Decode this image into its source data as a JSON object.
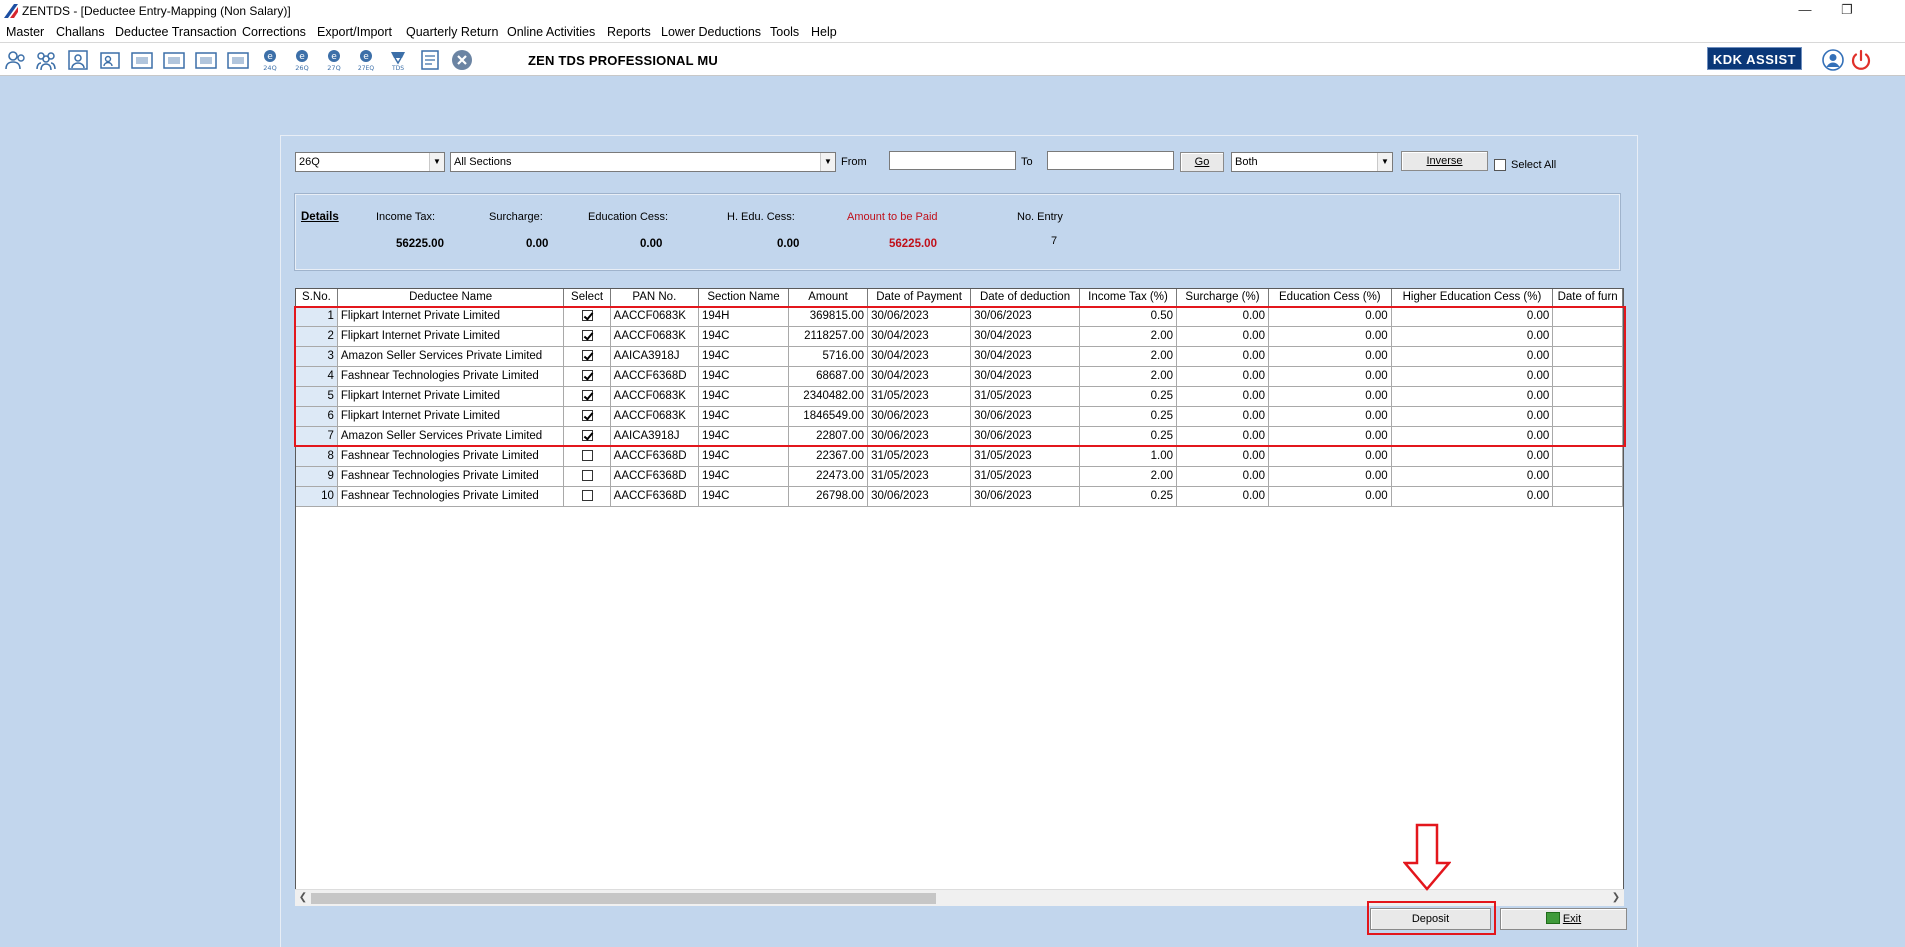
{
  "window": {
    "title": "ZENTDS - [Deductee Entry-Mapping (Non Salary)]",
    "minimize": "—",
    "restore": "❐"
  },
  "menu": [
    "Master",
    "Challans",
    "Deductee Transaction",
    "Corrections",
    "Export/Import",
    "Quarterly Return",
    "Online Activities",
    "Reports",
    "Lower Deductions",
    "Tools",
    "Help"
  ],
  "toolbar": {
    "icon_labels": [
      "24Q",
      "26Q",
      "27Q",
      "27EQ",
      "TDS"
    ],
    "brand": "ZEN TDS PROFESSIONAL MU",
    "assist_label": "KDK ASSIST"
  },
  "filters": {
    "form_type": "26Q",
    "section": "All Sections",
    "from_label": "From",
    "from_value": "",
    "to_label": "To",
    "to_value": "",
    "go_label": "Go",
    "mode": "Both",
    "inverse_label": "Inverse",
    "select_all_label": "Select All"
  },
  "details": {
    "title": "Details",
    "income_tax_label": "Income Tax:",
    "income_tax": "56225.00",
    "surcharge_label": "Surcharge:",
    "surcharge": "0.00",
    "edu_cess_label": "Education Cess:",
    "edu_cess": "0.00",
    "h_edu_cess_label": "H. Edu. Cess:",
    "h_edu_cess": "0.00",
    "amount_label": "Amount to be Paid",
    "amount": "56225.00",
    "entries_label": "No. Entry",
    "entries": "7",
    "amount_color": "#c0101a"
  },
  "grid": {
    "columns": [
      "S.No.",
      "Deductee Name",
      "Select",
      "PAN No.",
      "Section Name",
      "Amount",
      "Date of Payment",
      "Date of deduction",
      "Income Tax (%)",
      "Surcharge (%)",
      "Education Cess (%)",
      "Higher Education Cess (%)",
      "Date of furn"
    ],
    "rows": [
      {
        "sno": "1",
        "name": "Flipkart Internet Private Limited",
        "selected": true,
        "pan": "AACCF0683K",
        "section": "194H",
        "amount": "369815.00",
        "payment_date": "30/06/2023",
        "deduction_date": "30/06/2023",
        "it": "0.50",
        "sur": "0.00",
        "edu": "0.00",
        "hedu": "0.00"
      },
      {
        "sno": "2",
        "name": "Flipkart Internet Private Limited",
        "selected": true,
        "pan": "AACCF0683K",
        "section": "194C",
        "amount": "2118257.00",
        "payment_date": "30/04/2023",
        "deduction_date": "30/04/2023",
        "it": "2.00",
        "sur": "0.00",
        "edu": "0.00",
        "hedu": "0.00"
      },
      {
        "sno": "3",
        "name": "Amazon Seller Services Private Limited",
        "selected": true,
        "pan": "AAICA3918J",
        "section": "194C",
        "amount": "5716.00",
        "payment_date": "30/04/2023",
        "deduction_date": "30/04/2023",
        "it": "2.00",
        "sur": "0.00",
        "edu": "0.00",
        "hedu": "0.00"
      },
      {
        "sno": "4",
        "name": "Fashnear Technologies Private Limited",
        "selected": true,
        "pan": "AACCF6368D",
        "section": "194C",
        "amount": "68687.00",
        "payment_date": "30/04/2023",
        "deduction_date": "30/04/2023",
        "it": "2.00",
        "sur": "0.00",
        "edu": "0.00",
        "hedu": "0.00"
      },
      {
        "sno": "5",
        "name": "Flipkart Internet Private Limited",
        "selected": true,
        "pan": "AACCF0683K",
        "section": "194C",
        "amount": "2340482.00",
        "payment_date": "31/05/2023",
        "deduction_date": "31/05/2023",
        "it": "0.25",
        "sur": "0.00",
        "edu": "0.00",
        "hedu": "0.00"
      },
      {
        "sno": "6",
        "name": "Flipkart Internet Private Limited",
        "selected": true,
        "pan": "AACCF0683K",
        "section": "194C",
        "amount": "1846549.00",
        "payment_date": "30/06/2023",
        "deduction_date": "30/06/2023",
        "it": "0.25",
        "sur": "0.00",
        "edu": "0.00",
        "hedu": "0.00"
      },
      {
        "sno": "7",
        "name": "Amazon Seller Services Private Limited",
        "selected": true,
        "pan": "AAICA3918J",
        "section": "194C",
        "amount": "22807.00",
        "payment_date": "30/06/2023",
        "deduction_date": "30/06/2023",
        "it": "0.25",
        "sur": "0.00",
        "edu": "0.00",
        "hedu": "0.00"
      },
      {
        "sno": "8",
        "name": "Fashnear Technologies Private Limited",
        "selected": false,
        "pan": "AACCF6368D",
        "section": "194C",
        "amount": "22367.00",
        "payment_date": "31/05/2023",
        "deduction_date": "31/05/2023",
        "it": "1.00",
        "sur": "0.00",
        "edu": "0.00",
        "hedu": "0.00"
      },
      {
        "sno": "9",
        "name": "Fashnear Technologies Private Limited",
        "selected": false,
        "pan": "AACCF6368D",
        "section": "194C",
        "amount": "22473.00",
        "payment_date": "31/05/2023",
        "deduction_date": "31/05/2023",
        "it": "2.00",
        "sur": "0.00",
        "edu": "0.00",
        "hedu": "0.00"
      },
      {
        "sno": "10",
        "name": "Fashnear Technologies Private Limited",
        "selected": false,
        "pan": "AACCF6368D",
        "section": "194C",
        "amount": "26798.00",
        "payment_date": "30/06/2023",
        "deduction_date": "30/06/2023",
        "it": "0.25",
        "sur": "0.00",
        "edu": "0.00",
        "hedu": "0.00"
      }
    ]
  },
  "footer": {
    "deposit_label": "Deposit",
    "exit_label": "Exit"
  },
  "colors": {
    "background": "#c2d6ed",
    "highlight": "#e3161c",
    "brand_blue": "#0a3778"
  }
}
